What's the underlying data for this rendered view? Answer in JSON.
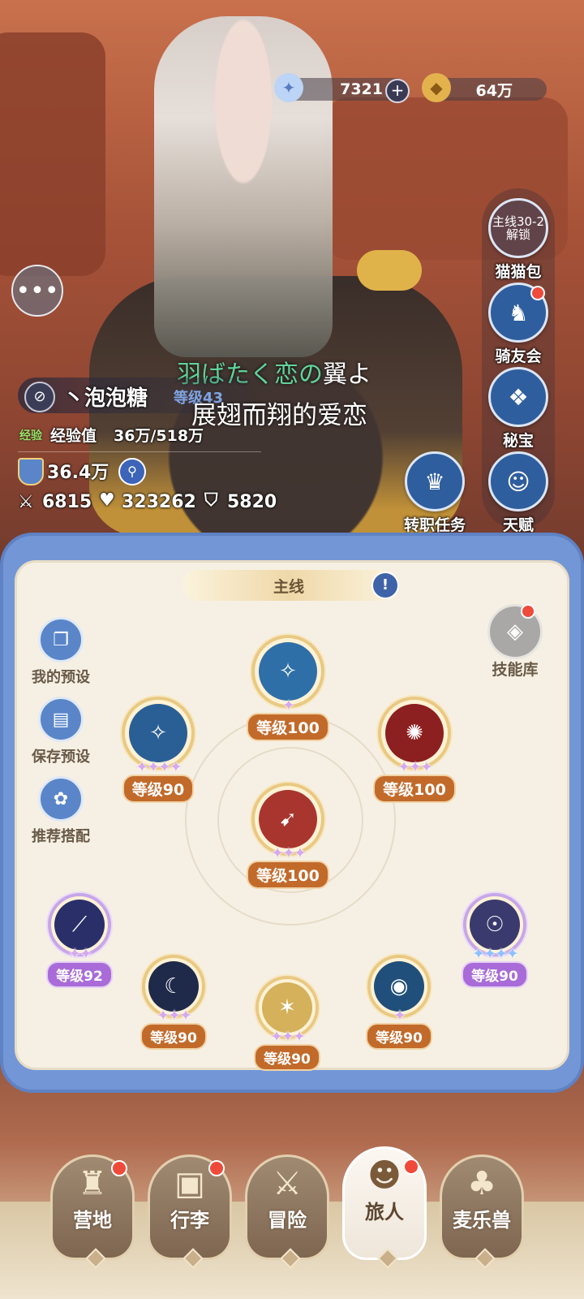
{
  "resources": {
    "gems": "7321",
    "gold": "64万",
    "gem_icon": "star-gem-icon",
    "gold_icon": "gold-coin-icon"
  },
  "side_buttons": {
    "cat_bag_lock": "主线30-2\n解锁",
    "cat_bag": "猫猫包",
    "rider_club": "骑友会",
    "treasure": "秘宝",
    "job_quest": "转职任务",
    "talent": "天赋"
  },
  "player": {
    "name": "丶泡泡糖",
    "level": "等级43",
    "exp_label": "经验",
    "exp_text": "经验值",
    "exp_value": "36万/518万",
    "power": "36.4万",
    "attack": "6815",
    "hp": "323262",
    "defense": "5820"
  },
  "lyrics": {
    "jp_green": "羽ばたく恋の",
    "jp_white": "翼よ",
    "cn": "展翅而翔的爱恋"
  },
  "panel": {
    "tab_title": "主线",
    "my_preset": "我的预设",
    "save_preset": "保存预设",
    "recommend": "推荐搭配",
    "skill_library": "技能库"
  },
  "skills": [
    {
      "level": "等级100",
      "stars": "✦",
      "color": "#2f6fa8"
    },
    {
      "level": "等级90",
      "stars": "✦✦✦✦",
      "color": "#2a5f95"
    },
    {
      "level": "等级100",
      "stars": "✦✦✦",
      "color": "#8c1f1f"
    },
    {
      "level": "等级100",
      "stars": "✦✦✦",
      "color": "#a8352e"
    },
    {
      "level": "等级92",
      "stars": "✦✦",
      "color": "#2a2f6a"
    },
    {
      "level": "等级90",
      "stars": "✦✦✦✦",
      "color": "#3a3a6e"
    },
    {
      "level": "等级90",
      "stars": "✦✦✦",
      "color": "#1f2a4a"
    },
    {
      "level": "等级90",
      "stars": "✦✦✦",
      "color": "#d4b15a"
    },
    {
      "level": "等级90",
      "stars": "✦",
      "color": "#1f4f7a"
    }
  ],
  "nav": {
    "camp": "营地",
    "luggage": "行李",
    "adventure": "冒险",
    "traveler": "旅人",
    "pet": "麦乐兽"
  }
}
